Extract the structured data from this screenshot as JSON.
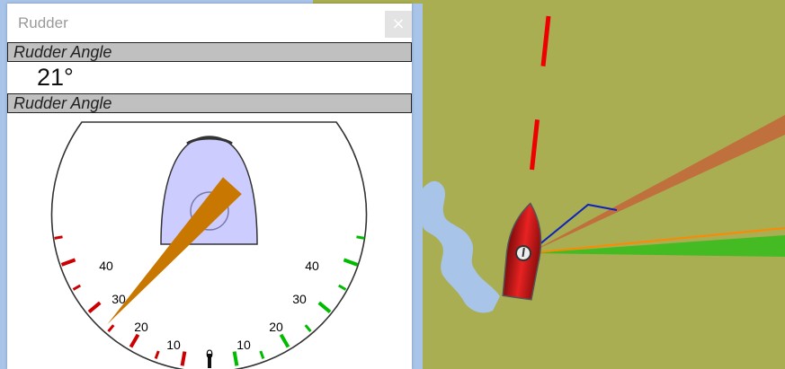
{
  "window": {
    "title": "Rudder",
    "close_glyph": "×"
  },
  "sections": [
    {
      "label": "Rudder Angle"
    },
    {
      "label": "Rudder Angle"
    }
  ],
  "readout": {
    "value": "21°"
  },
  "gauge": {
    "rudder_angle_deg": 21,
    "port_color": "#cc0000",
    "starboard_color": "#00bb00",
    "needle_color": "#c87800",
    "hull_fill": "#ccccff",
    "tick_labels_left": [
      "40",
      "30",
      "20",
      "10"
    ],
    "tick_labels_right": [
      "40",
      "30",
      "20",
      "10"
    ],
    "center_label": "0"
  },
  "map": {
    "land_color": "#a9ae52",
    "water_color": "#a8c4e8",
    "boat_color": "#cc1111",
    "heading_line_color": "#ee0000",
    "wind_cone_color": "#c0703c",
    "cog_line_color": "#ff8800",
    "green_cone_color": "#44bb22",
    "track_color": "#1122bb"
  }
}
